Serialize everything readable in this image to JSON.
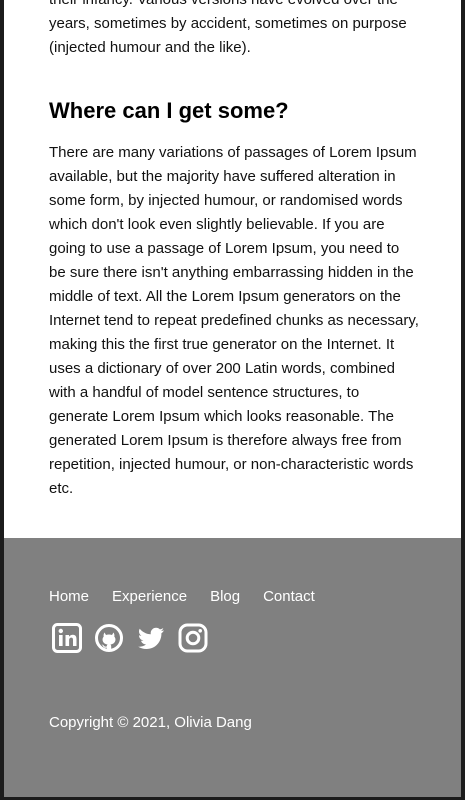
{
  "article": {
    "intro_tail": "their infancy. Various versions have evolved over the years, sometimes by accident, sometimes on purpose (injected humour and the like).",
    "heading": "Where can I get some?",
    "body": "There are many variations of passages of Lorem Ipsum available, but the majority have suffered alteration in some form, by injected humour, or randomised words which don't look even slightly believable. If you are going to use a passage of Lorem Ipsum, you need to be sure there isn't anything embarrassing hidden in the middle of text. All the Lorem Ipsum generators on the Internet tend to repeat predefined chunks as necessary, making this the first true generator on the Internet. It uses a dictionary of over 200 Latin words, combined with a handful of model sentence structures, to generate Lorem Ipsum which looks reasonable. The generated Lorem Ipsum is therefore always free from repetition, injected humour, or non-characteristic words etc."
  },
  "footer": {
    "nav": [
      {
        "label": "Home"
      },
      {
        "label": "Experience"
      },
      {
        "label": "Blog"
      },
      {
        "label": "Contact"
      }
    ],
    "social_icons": [
      "linkedin-icon",
      "github-icon",
      "twitter-icon",
      "instagram-icon"
    ],
    "copyright": "Copyright © 2021, Olivia Dang"
  },
  "colors": {
    "page_background": "#ffffff",
    "footer_background": "#808080",
    "footer_text": "#ffffff",
    "frame_border": "#1c1c1c"
  }
}
